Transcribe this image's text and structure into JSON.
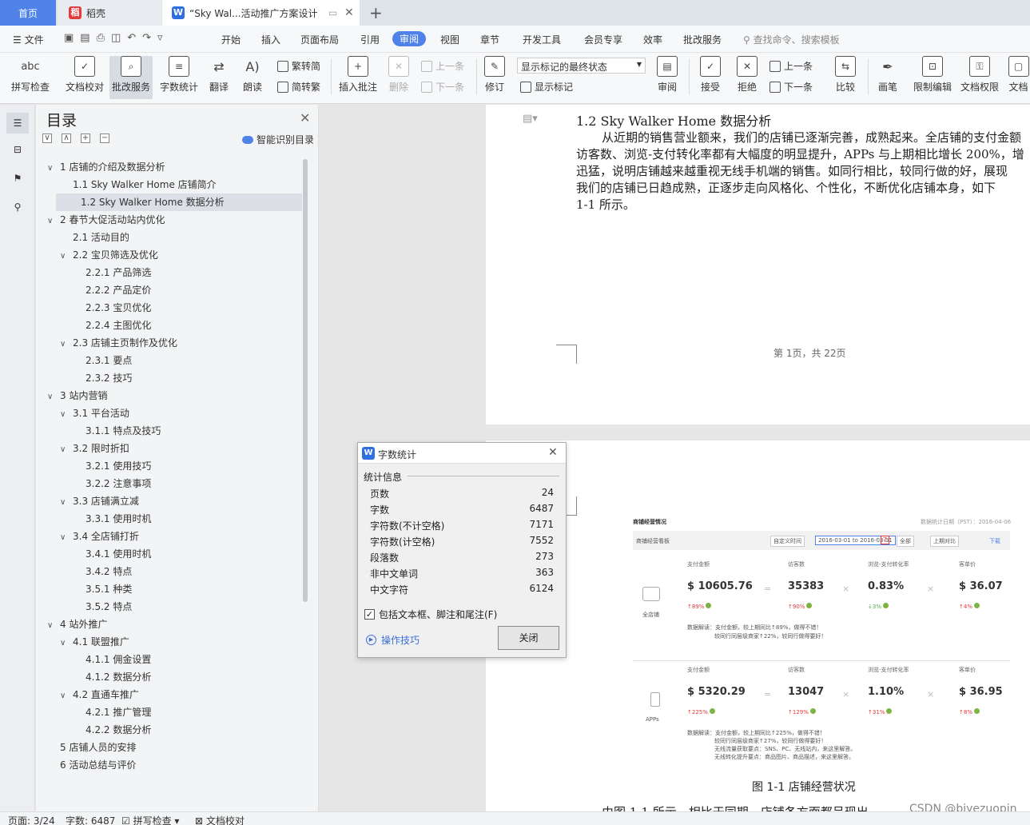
{
  "tabs": {
    "home": "首页",
    "daoke": "稻壳",
    "doc": "“Sky Wal...活动推广方案设计"
  },
  "menu": [
    "文件",
    "开始",
    "插入",
    "页面布局",
    "引用",
    "审阅",
    "视图",
    "章节",
    "开发工具",
    "会员专享",
    "效率",
    "批改服务"
  ],
  "search_placeholder": "查找命令、搜索模板",
  "ribbon": {
    "spell": "拼写检查",
    "proof": "文档校对",
    "grade": "批改服务",
    "wordcount": "字数统计",
    "translate": "翻译",
    "read": "朗读",
    "trad": "繁转简",
    "simp": "简转繁",
    "insert_comment": "插入批注",
    "delete": "删除",
    "prev": "上一条",
    "next": "下一条",
    "revise": "修订",
    "markup_state": "显示标记的最终状态",
    "show_markup": "显示标记",
    "review": "审阅",
    "accept": "接受",
    "reject": "拒绝",
    "prev2": "上一条",
    "next2": "下一条",
    "compare": "比较",
    "pen": "画笔",
    "restrict": "限制编辑",
    "perm": "文档权限",
    "docx": "文档"
  },
  "outline": {
    "title": "目录",
    "smart": "智能识别目录",
    "items": [
      {
        "label": "1 店铺的介绍及数据分析",
        "level": 0,
        "chev": "∨"
      },
      {
        "label": "1.1 Sky Walker Home 店铺简介",
        "level": 1,
        "chev": ""
      },
      {
        "label": "1.2 Sky Walker Home 数据分析",
        "level": 1,
        "chev": "",
        "selected": true
      },
      {
        "label": "2 春节大促活动站内优化",
        "level": 0,
        "chev": "∨"
      },
      {
        "label": "2.1 活动目的",
        "level": 1,
        "chev": ""
      },
      {
        "label": "2.2 宝贝筛选及优化",
        "level": 1,
        "chev": "∨"
      },
      {
        "label": "2.2.1 产品筛选",
        "level": 2,
        "chev": ""
      },
      {
        "label": "2.2.2 产品定价",
        "level": 2,
        "chev": ""
      },
      {
        "label": "2.2.3 宝贝优化",
        "level": 2,
        "chev": ""
      },
      {
        "label": "2.2.4  主图优化",
        "level": 2,
        "chev": ""
      },
      {
        "label": "2.3 店铺主页制作及优化",
        "level": 1,
        "chev": "∨"
      },
      {
        "label": "2.3.1 要点",
        "level": 2,
        "chev": ""
      },
      {
        "label": "2.3.2 技巧",
        "level": 2,
        "chev": ""
      },
      {
        "label": "3 站内营销",
        "level": 0,
        "chev": "∨"
      },
      {
        "label": "3.1 平台活动",
        "level": 1,
        "chev": "∨"
      },
      {
        "label": "3.1.1 特点及技巧",
        "level": 2,
        "chev": ""
      },
      {
        "label": "3.2 限时折扣",
        "level": 1,
        "chev": "∨"
      },
      {
        "label": "3.2.1 使用技巧",
        "level": 2,
        "chev": ""
      },
      {
        "label": "3.2.2 注意事项",
        "level": 2,
        "chev": ""
      },
      {
        "label": "3.3 店铺满立减",
        "level": 1,
        "chev": "∨"
      },
      {
        "label": "3.3.1 使用时机",
        "level": 2,
        "chev": ""
      },
      {
        "label": "3.4 全店铺打折",
        "level": 1,
        "chev": "∨"
      },
      {
        "label": "3.4.1 使用时机",
        "level": 2,
        "chev": ""
      },
      {
        "label": "3.4.2 特点",
        "level": 2,
        "chev": ""
      },
      {
        "label": "3.5.1 种类",
        "level": 2,
        "chev": ""
      },
      {
        "label": "3.5.2 特点",
        "level": 2,
        "chev": ""
      },
      {
        "label": "4 站外推广",
        "level": 0,
        "chev": "∨"
      },
      {
        "label": "4.1 联盟推广",
        "level": 1,
        "chev": "∨"
      },
      {
        "label": "4.1.1  佣金设置",
        "level": 2,
        "chev": ""
      },
      {
        "label": "4.1.2  数据分析",
        "level": 2,
        "chev": ""
      },
      {
        "label": "4.2 直通车推广",
        "level": 1,
        "chev": "∨"
      },
      {
        "label": "4.2.1 推广管理",
        "level": 2,
        "chev": ""
      },
      {
        "label": "4.2.2 数据分析",
        "level": 2,
        "chev": ""
      },
      {
        "label": "5 店铺人员的安排",
        "level": 0,
        "chev": ""
      },
      {
        "label": "6 活动总结与评价",
        "level": 0,
        "chev": ""
      }
    ]
  },
  "doc": {
    "heading": "1.2 Sky Walker Home 数据分析",
    "lines": [
      "从近期的销售营业额来，我们的店铺已逐渐完善，成熟起来。全店铺的支付金额",
      "访客数、浏览-支付转化率都有大幅度的明显提升，APPs 与上期相比增长 200%，增",
      "迅猛，说明店铺越来越重视无线手机端的销售。如同行相比，较同行做的好，展现",
      "我们的店铺已日趋成熟，正逐步走向风格化、个性化，不断优化店铺本身，如下",
      "1-1 所示。"
    ],
    "footer": "第 1页，共 22页",
    "caption": "图 1-1 店铺经营状况",
    "bottom_text": "由图 1-1 所示，相比于同期，店铺各方面都呈现出"
  },
  "embedded": {
    "title": "商铺经营情况",
    "date": "数据统计日期（PST）：2016-04-06",
    "board": "商铺经营看板",
    "filter1": "自定义时间",
    "range": "2016-03-01 to 2016-03-31",
    "range_icon": "7",
    "filter2": "全部",
    "filter3": "上期对比",
    "download": "下载",
    "headers": [
      "支付金额",
      "访客数",
      "浏览-支付转化率",
      "客单价"
    ],
    "shop": {
      "label": "全店铺",
      "values": [
        "$ 10605.76",
        "35383",
        "0.83%",
        "$ 36.07"
      ],
      "changes": [
        "↑89%",
        "↑90%",
        "↓3%",
        "↑4%"
      ],
      "note1": "数据解读：支付金额，较上期同比↑89%，做得不错！",
      "note2": "较同行同层级商家↑22%，较同行做得要好！"
    },
    "apps": {
      "label": "APPs",
      "values": [
        "$ 5320.29",
        "13047",
        "1.10%",
        "$ 36.95"
      ],
      "changes": [
        "↑225%",
        "↑129%",
        "↑31%",
        "↑8%"
      ],
      "note1": "数据解读：支付金额，较上期同比↑225%，做得不错！",
      "note2": "较同行同层级商家↑27%，较同行做得要好！",
      "note3": "无线流量获取要点：SNS、PC、无线站内，来这里解答。",
      "note4": "无线转化提升要点：商品图片、商品描述，来这里解答。"
    },
    "ops": [
      "=",
      "×",
      "×"
    ]
  },
  "dialog": {
    "title": "字数统计",
    "section": "统计信息",
    "rows": [
      {
        "label": "页数",
        "value": "24"
      },
      {
        "label": "字数",
        "value": "6487"
      },
      {
        "label": "字符数(不计空格)",
        "value": "7171"
      },
      {
        "label": "字符数(计空格)",
        "value": "7552"
      },
      {
        "label": "段落数",
        "value": "273"
      },
      {
        "label": "非中文单词",
        "value": "363"
      },
      {
        "label": "中文字符",
        "value": "6124"
      }
    ],
    "checkbox": "包括文本框、脚注和尾注(F)",
    "tips": "操作技巧",
    "close": "关闭"
  },
  "status": {
    "page": "页面: 3/24",
    "words": "字数: 6487",
    "spell": "拼写检查",
    "proof": "文档校对"
  },
  "watermark": "CSDN @biyezuopin",
  "colors": {
    "accent": "#4f83e9",
    "tabbar": "#dfe3ea"
  }
}
